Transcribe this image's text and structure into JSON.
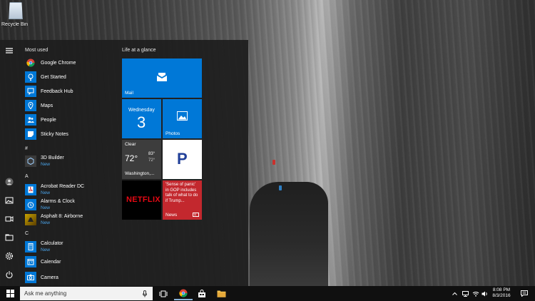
{
  "desktop": {
    "icons": [
      {
        "label": "Recycle Bin",
        "icon": "recycle-bin-icon"
      }
    ]
  },
  "start_menu": {
    "rail": [
      {
        "icon": "hamburger-menu-icon"
      },
      {
        "icon": "user-account-icon"
      },
      {
        "icon": "pictures-icon"
      },
      {
        "icon": "videos-icon"
      },
      {
        "icon": "file-explorer-icon"
      },
      {
        "icon": "settings-gear-icon"
      },
      {
        "icon": "power-icon"
      }
    ],
    "most_used_label": "Most used",
    "most_used": [
      {
        "name": "Google Chrome",
        "icon": "chrome-icon",
        "color": "#ffffff"
      },
      {
        "name": "Get Started",
        "icon": "lightbulb-icon",
        "color": "#0078d7"
      },
      {
        "name": "Feedback Hub",
        "icon": "feedback-icon",
        "color": "#0078d7"
      },
      {
        "name": "Maps",
        "icon": "maps-icon",
        "color": "#0078d7"
      },
      {
        "name": "People",
        "icon": "people-icon",
        "color": "#0078d7"
      },
      {
        "name": "Sticky Notes",
        "icon": "sticky-notes-icon",
        "color": "#0078d7"
      }
    ],
    "groups": [
      {
        "letter": "#",
        "apps": [
          {
            "name": "3D Builder",
            "sub": "New",
            "icon": "3d-builder-icon",
            "color": "#3a3a3a"
          }
        ]
      },
      {
        "letter": "A",
        "apps": [
          {
            "name": "Acrobat Reader DC",
            "sub": "New",
            "icon": "acrobat-icon",
            "color": "#0078d7"
          },
          {
            "name": "Alarms & Clock",
            "sub": "New",
            "icon": "alarm-clock-icon",
            "color": "#0078d7"
          },
          {
            "name": "Asphalt 8: Airborne",
            "sub": "New",
            "icon": "asphalt-game-icon",
            "color": "#c8a200"
          }
        ]
      },
      {
        "letter": "C",
        "apps": [
          {
            "name": "Calculator",
            "sub": "New",
            "icon": "calculator-icon",
            "color": "#0078d7"
          },
          {
            "name": "Calendar",
            "sub": "",
            "icon": "calendar-icon",
            "color": "#0078d7"
          },
          {
            "name": "Camera",
            "sub": "",
            "icon": "camera-icon",
            "color": "#0078d7"
          }
        ]
      }
    ],
    "tiles_header": "Life at a glance",
    "tiles": {
      "mail": {
        "label": "Mail",
        "color": "#0078d7"
      },
      "calendar": {
        "day": "Wednesday",
        "date": "3",
        "color": "#0078d7"
      },
      "photos": {
        "label": "Photos",
        "color": "#0078d7"
      },
      "weather": {
        "condition": "Clear",
        "temp": "72°",
        "high": "83°",
        "low": "72°",
        "location": "Washington,..."
      },
      "pandora": {
        "letter": "P",
        "color": "#ffffff"
      },
      "netflix": {
        "label": "NETFLIX",
        "color": "#000000"
      },
      "news": {
        "headline": "'Sense of panic' in GOP includes talk of what to do if Trump...",
        "label": "News",
        "color": "#c3282e"
      }
    }
  },
  "taskbar": {
    "search_placeholder": "Ask me anything",
    "pinned": [
      {
        "icon": "task-view-icon"
      },
      {
        "icon": "chrome-icon"
      },
      {
        "icon": "store-icon"
      },
      {
        "icon": "file-explorer-icon"
      }
    ],
    "tray": [
      {
        "icon": "chevron-up-icon"
      },
      {
        "icon": "network-icon"
      },
      {
        "icon": "wifi-icon"
      },
      {
        "icon": "volume-icon"
      }
    ],
    "time": "8:08 PM",
    "date": "8/3/2016",
    "notifications_icon": "action-center-icon"
  }
}
